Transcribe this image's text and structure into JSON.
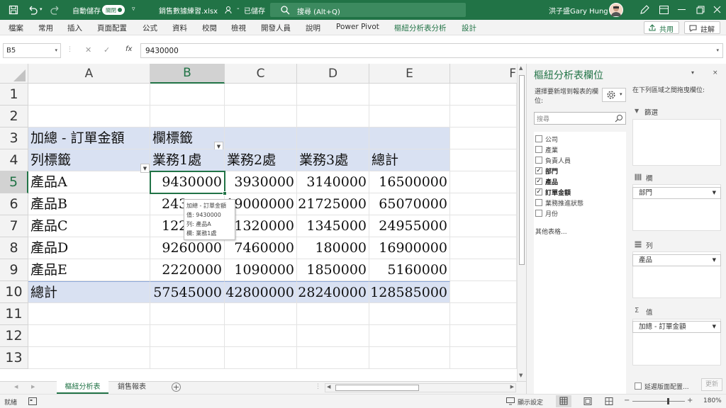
{
  "titlebar": {
    "autosave_label": "自動儲存",
    "autosave_state": "關閉",
    "filename": "銷售數據練習.xlsx",
    "save_status": "已儲存",
    "search_placeholder": "搜尋 (Alt+Q)",
    "user_name": "洪子盛Gary Hung",
    "accent_color": "#217346"
  },
  "ribbon": {
    "tabs": [
      "檔案",
      "常用",
      "插入",
      "頁面配置",
      "公式",
      "資料",
      "校閱",
      "檢視",
      "開發人員",
      "說明",
      "Power Pivot",
      "樞紐分析表分析",
      "設計"
    ],
    "share_label": "共用",
    "comment_label": "註解"
  },
  "formula_bar": {
    "name_box": "B5",
    "value": "9430000",
    "fx": "fx"
  },
  "sheet": {
    "columns": [
      "A",
      "B",
      "C",
      "D",
      "E",
      "F"
    ],
    "rows": [
      "1",
      "2",
      "3",
      "4",
      "5",
      "6",
      "7",
      "8",
      "9",
      "10",
      "11",
      "12",
      "13"
    ],
    "pivot": {
      "value_label": "加總 - 訂單金額",
      "col_labels_header": "欄標籤",
      "row_labels_header": "列標籤",
      "col_headers": [
        "業務1處",
        "業務2處",
        "業務3處",
        "總計"
      ],
      "rows": [
        {
          "label": "產品A",
          "values": [
            "9430000",
            "3930000",
            "3140000",
            "16500000"
          ]
        },
        {
          "label": "產品B",
          "values": [
            "243",
            "19000000",
            "21725000",
            "65070000"
          ]
        },
        {
          "label": "產品C",
          "values": [
            "122",
            "11320000",
            "1345000",
            "24955000"
          ]
        },
        {
          "label": "產品D",
          "values": [
            "9260000",
            "7460000",
            "180000",
            "16900000"
          ]
        },
        {
          "label": "產品E",
          "values": [
            "2220000",
            "1090000",
            "1850000",
            "5160000"
          ]
        }
      ],
      "total_label": "總計",
      "totals": [
        "57545000",
        "42800000",
        "28240000",
        "128585000"
      ]
    },
    "tooltip": {
      "line1": "加總 - 訂單金額",
      "line2": "值: 9430000",
      "line3": "列: 產品A",
      "line4": "欄: 業務1處"
    },
    "band_color": "#d9e1f2"
  },
  "sheet_tabs": {
    "items": [
      "樞紐分析表",
      "銷售報表"
    ],
    "active": "樞紐分析表"
  },
  "pivot_pane": {
    "title": "樞紐分析表欄位",
    "choose_label": "選擇要新增到報表的欄位:",
    "search_placeholder": "搜尋",
    "fields": [
      {
        "name": "公司",
        "checked": false
      },
      {
        "name": "產業",
        "checked": false
      },
      {
        "name": "負責人員",
        "checked": false
      },
      {
        "name": "部門",
        "checked": true
      },
      {
        "name": "產品",
        "checked": true
      },
      {
        "name": "訂單金額",
        "checked": true
      },
      {
        "name": "業務推進狀態",
        "checked": false
      },
      {
        "name": "月份",
        "checked": false
      }
    ],
    "more_tables": "其他表格...",
    "drag_label": "在下列區域之間拖曳欄位:",
    "filter_label": "篩選",
    "columns_label": "欄",
    "columns_item": "部門",
    "rows_label": "列",
    "rows_item": "產品",
    "values_label": "值",
    "values_item": "加總 - 訂單金額",
    "defer_label": "延遲版面配置...",
    "update_label": "更新"
  },
  "status_bar": {
    "ready": "就緒",
    "display_settings": "顯示設定",
    "zoom": "180%"
  }
}
